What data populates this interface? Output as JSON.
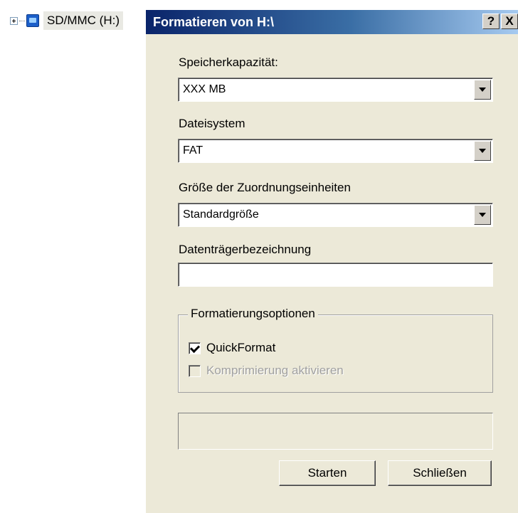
{
  "tree": {
    "drive_label": "SD/MMC (H:)"
  },
  "dialog": {
    "title": "Formatieren von H:\\",
    "help_button": "?",
    "close_button": "X",
    "capacity": {
      "label": "Speicherkapazität:",
      "value": "XXX  MB"
    },
    "filesystem": {
      "label": "Dateisystem",
      "value": "FAT"
    },
    "allocation": {
      "label": "Größe der Zuordnungseinheiten",
      "value": "Standardgröße"
    },
    "volume_label": {
      "label": "Datenträgerbezeichnung",
      "value": ""
    },
    "options": {
      "legend": "Formatierungsoptionen",
      "quick_format": {
        "label": "QuickFormat",
        "checked": true
      },
      "compression": {
        "label": "Komprimierung aktivieren",
        "checked": false,
        "enabled": false
      }
    },
    "buttons": {
      "start": "Starten",
      "close": "Schließen"
    }
  }
}
